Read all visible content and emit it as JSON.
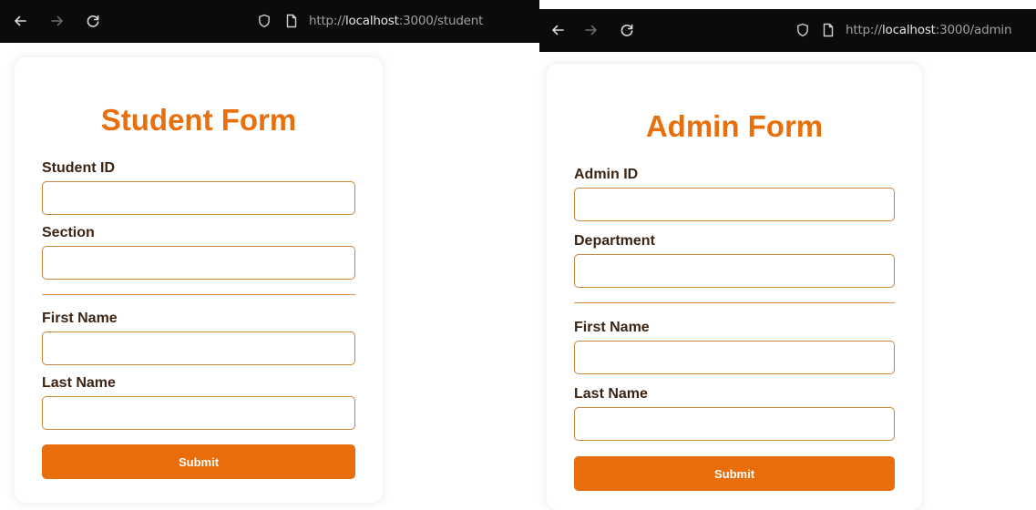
{
  "left_window": {
    "url_prefix": "http://",
    "url_host": "localhost",
    "url_path": ":3000/student",
    "form": {
      "title": "Student Form",
      "fields": [
        {
          "label": "Student ID",
          "value": ""
        },
        {
          "label": "Section",
          "value": ""
        },
        {
          "label": "First Name",
          "value": ""
        },
        {
          "label": "Last Name",
          "value": ""
        }
      ],
      "submit_label": "Submit"
    }
  },
  "right_window": {
    "url_prefix": "http://",
    "url_host": "localhost",
    "url_path": ":3000/admin",
    "form": {
      "title": "Admin Form",
      "fields": [
        {
          "label": "Admin ID",
          "value": ""
        },
        {
          "label": "Department",
          "value": ""
        },
        {
          "label": "First Name",
          "value": ""
        },
        {
          "label": "Last Name",
          "value": ""
        }
      ],
      "submit_label": "Submit"
    }
  },
  "icons": {
    "back": "arrow-left-icon",
    "forward": "arrow-right-icon",
    "reload": "reload-icon",
    "tracking_protection": "shield-icon",
    "page_info": "page-icon"
  },
  "colors": {
    "accent": "#e96d0a",
    "title": "#e8700c",
    "label": "#3a2414",
    "input_border": "#c9833e",
    "chrome_bg": "#0b0b0b"
  }
}
